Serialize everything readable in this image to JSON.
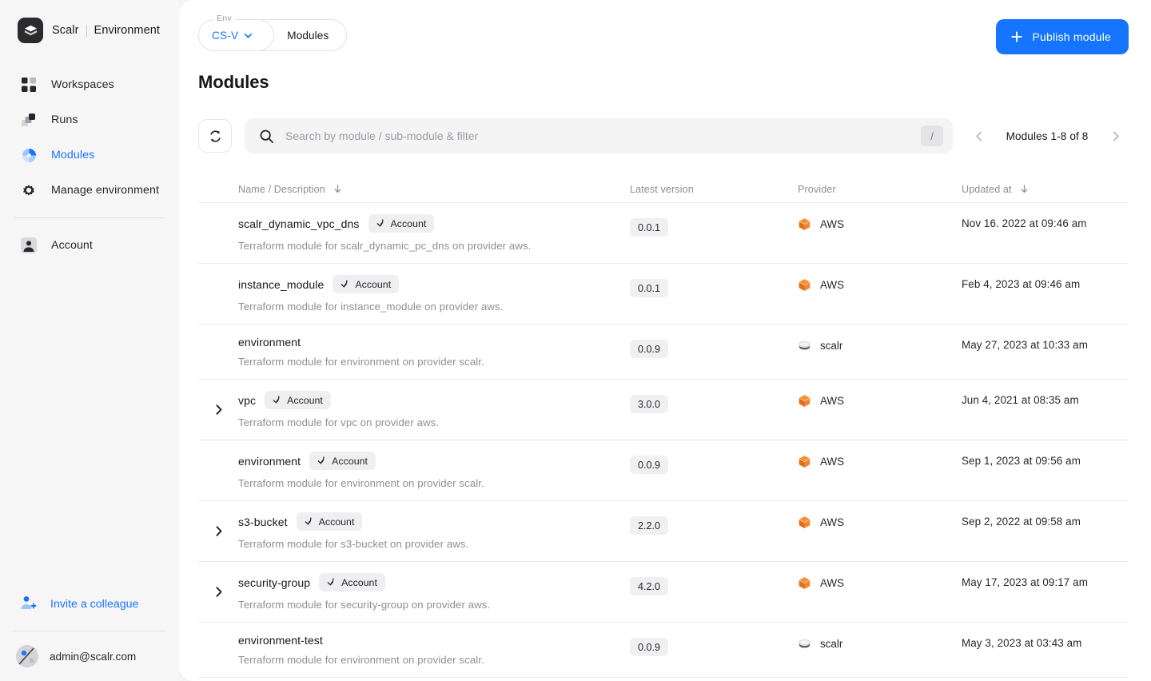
{
  "brand": {
    "name": "Scalr",
    "scope": "Environment",
    "logo_icon": "scalr-layers-logo"
  },
  "sidebar": {
    "items": [
      {
        "label": "Workspaces",
        "icon": "grid-squares-icon",
        "active": false
      },
      {
        "label": "Runs",
        "icon": "stacked-squares-icon",
        "active": false
      },
      {
        "label": "Modules",
        "icon": "pie-quadrants-icon",
        "active": true
      },
      {
        "label": "Manage environment",
        "icon": "gear-icon",
        "active": false
      }
    ],
    "account_item": {
      "label": "Account",
      "icon": "person-icon"
    },
    "invite": {
      "label": "Invite a colleague",
      "icon": "person-add-icon"
    },
    "user": {
      "email": "admin@scalr.com",
      "avatar_icon": "user-avatar"
    }
  },
  "breadcrumb": {
    "env_label": "Env",
    "env_value": "CS-V",
    "env_chevron_icon": "chevron-down-icon",
    "page": "Modules"
  },
  "header": {
    "publish_label": "Publish module",
    "publish_icon": "plus-icon",
    "publish_color": "#1575ff",
    "page_title": "Modules"
  },
  "toolbar": {
    "refresh_icon": "refresh-loop-icon",
    "search_placeholder": "Search by module / sub-module & filter",
    "search_value": "",
    "search_icon": "search-icon",
    "shortcut_key": "/",
    "pager": {
      "prev_icon": "chevron-left-icon",
      "next_icon": "chevron-right-icon",
      "label": "Modules 1-8 of 8"
    }
  },
  "table": {
    "columns": [
      {
        "label": "Name / Description",
        "sort_icon": "arrow-down-icon",
        "sortable": true
      },
      {
        "label": "Latest version",
        "sort_icon": "",
        "sortable": false
      },
      {
        "label": "Provider",
        "sort_icon": "",
        "sortable": false
      },
      {
        "label": "Updated at",
        "sort_icon": "arrow-down-icon",
        "sortable": true
      }
    ],
    "badge_icon": "arrow-hook-down-icon",
    "expand_icon": "chevron-right-icon",
    "rows": [
      {
        "name": "scalr_dynamic_vpc_dns",
        "scope_badge": "Account",
        "description": "Terraform module for scalr_dynamic_pc_dns on provider aws.",
        "version": "0.0.1",
        "provider": "AWS",
        "provider_icon": "aws-cube-icon",
        "updated_at": "Nov 16. 2022 at 09:46 am",
        "expandable": false
      },
      {
        "name": "instance_module",
        "scope_badge": "Account",
        "description": "Terraform module for instance_module on provider aws.",
        "version": "0.0.1",
        "provider": "AWS",
        "provider_icon": "aws-cube-icon",
        "updated_at": "Feb 4, 2023 at 09:46 am",
        "expandable": false
      },
      {
        "name": "environment",
        "scope_badge": "",
        "description": "Terraform module for environment on provider scalr.",
        "version": "0.0.9",
        "provider": "scalr",
        "provider_icon": "scalr-disc-icon",
        "updated_at": "May 27, 2023 at 10:33 am",
        "expandable": false
      },
      {
        "name": "vpc",
        "scope_badge": "Account",
        "description": "Terraform module for vpc on provider aws.",
        "version": "3.0.0",
        "provider": "AWS",
        "provider_icon": "aws-cube-icon",
        "updated_at": "Jun 4, 2021 at 08:35 am",
        "expandable": true
      },
      {
        "name": "environment",
        "scope_badge": "Account",
        "description": "Terraform module for environment on provider scalr.",
        "version": "0.0.9",
        "provider": "AWS",
        "provider_icon": "aws-cube-icon",
        "updated_at": "Sep 1, 2023 at 09:56 am",
        "expandable": false
      },
      {
        "name": "s3-bucket",
        "scope_badge": "Account",
        "description": "Terraform module for s3-bucket on provider aws.",
        "version": "2.2.0",
        "provider": "AWS",
        "provider_icon": "aws-cube-icon",
        "updated_at": "Sep 2, 2022 at 09:58 am",
        "expandable": true
      },
      {
        "name": "security-group",
        "scope_badge": "Account",
        "description": "Terraform module for security-group on provider aws.",
        "version": "4.2.0",
        "provider": "AWS",
        "provider_icon": "aws-cube-icon",
        "updated_at": "May 17, 2023 at 09:17 am",
        "expandable": true
      },
      {
        "name": "environment-test",
        "scope_badge": "",
        "description": "Terraform module for environment on provider scalr.",
        "version": "0.0.9",
        "provider": "scalr",
        "provider_icon": "scalr-disc-icon",
        "updated_at": "May 3, 2023 at 03:43 am",
        "expandable": false
      }
    ]
  },
  "colors": {
    "accent": "#1575ff",
    "link": "#1a73ff",
    "aws_orange": "#f58536",
    "text": "#18181b",
    "muted": "#8e8e96"
  }
}
